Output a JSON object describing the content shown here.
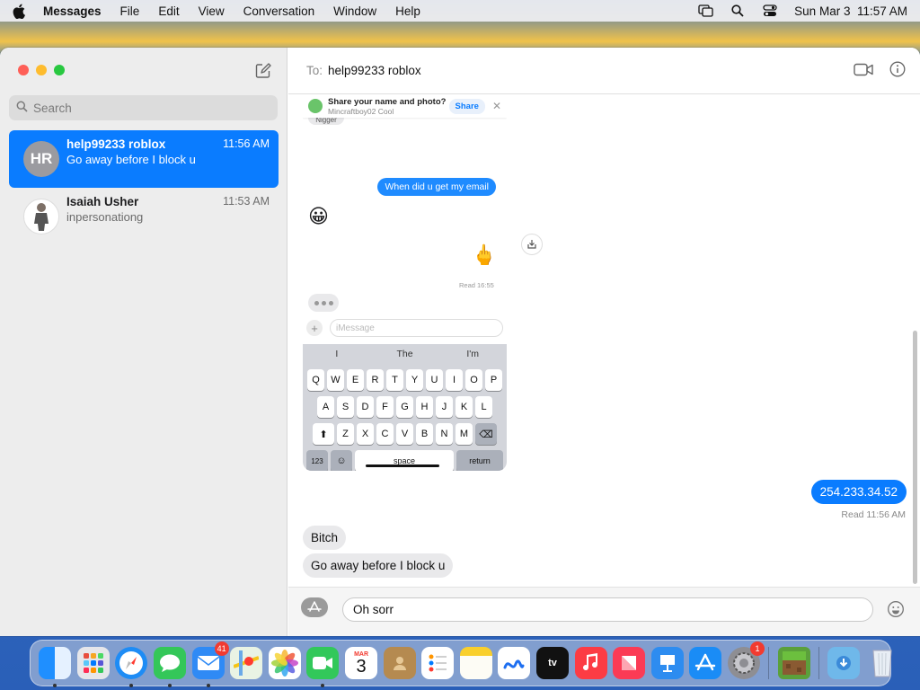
{
  "menubar": {
    "app_name": "Messages",
    "items": [
      "File",
      "Edit",
      "View",
      "Conversation",
      "Window",
      "Help"
    ],
    "clock": "Sun Mar 3  11:57 AM"
  },
  "sidebar": {
    "search_placeholder": "Search",
    "conversations": [
      {
        "initials": "HR",
        "name": "help99233 roblox",
        "time": "11:56 AM",
        "preview": "Go away before I block u",
        "selected": true
      },
      {
        "initials": "",
        "name": "Isaiah Usher",
        "time": "11:53 AM",
        "preview": "inpersonationg",
        "selected": false
      }
    ]
  },
  "header": {
    "to_label": "To:",
    "recipient": "help99233 roblox"
  },
  "screenshot": {
    "banner_title": "Share your name and photo?",
    "banner_subtitle": "Mincraftboy02 Cool",
    "share_label": "Share",
    "cut_text": "Nigger",
    "bubble_email": "When did u get my email",
    "emoji_1": "😀",
    "emoji_2": "🖕",
    "read_label": "Read 16:55",
    "input_placeholder": "iMessage",
    "suggestions": [
      "I",
      "The",
      "I'm"
    ],
    "row1": [
      "Q",
      "W",
      "E",
      "R",
      "T",
      "Y",
      "U",
      "I",
      "O",
      "P"
    ],
    "row2": [
      "A",
      "S",
      "D",
      "F",
      "G",
      "H",
      "J",
      "K",
      "L"
    ],
    "row3": [
      "Z",
      "X",
      "C",
      "V",
      "B",
      "N",
      "M"
    ],
    "key_123": "123",
    "key_space": "space",
    "key_return": "return"
  },
  "thread": {
    "outgoing_text": "254.233.34.52",
    "read_receipt": "Read 11:56 AM",
    "incoming": [
      "Bitch",
      "Go away before I block u"
    ]
  },
  "composer": {
    "draft": "Oh sorr"
  },
  "dock": {
    "mail_badge": "41",
    "calendar_month": "MAR",
    "calendar_day": "3",
    "settings_badge": "1"
  }
}
